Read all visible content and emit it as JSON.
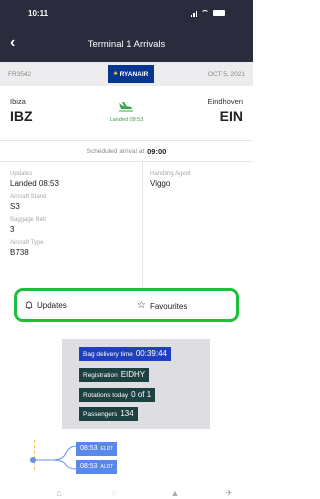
{
  "status_bar": {
    "time": "10:11"
  },
  "header": {
    "back_label": "‹",
    "title": "Terminal 1 Arrivals"
  },
  "flight": {
    "number": "FR3542",
    "airline": "RYANAIR",
    "date": "OCT 5, 2021",
    "from_city": "Ibiza",
    "from_code": "IBZ",
    "to_city": "Eindhoven",
    "to_code": "EIN",
    "status": "Landed 08:53",
    "scheduled_label": "Scheduled arrival at",
    "scheduled_time": "09:00"
  },
  "details": {
    "updates_label": "Updates",
    "updates_value": "Landed 08:53",
    "stand_label": "Aircraft Stand",
    "stand_value": "S3",
    "belt_label": "Baggage Belt",
    "belt_value": "3",
    "type_label": "Aircraft Type",
    "type_value": "B738",
    "agent_label": "Handling Agent",
    "agent_value": "Viggo"
  },
  "actions": {
    "updates": "Updates",
    "favourites": "Favourites"
  },
  "photo_tags": {
    "bag_delivery_label": "Bag delivery time",
    "bag_delivery_value": "00:39:44",
    "registration_label": "Registration",
    "registration_value": "EIDHY",
    "rotations_label": "Rotations today",
    "rotations_value": "0 of 1",
    "passengers_label": "Passengers",
    "passengers_value": "134"
  },
  "timeline": [
    {
      "time": "08:53",
      "code": "ELDT"
    },
    {
      "time": "08:53",
      "code": "ALDT"
    }
  ],
  "bottom_nav": [
    "home-icon",
    "chat-icon",
    "bell-icon",
    "plane-icon"
  ],
  "colors": {
    "header_bg": "#2b2b3e",
    "accent_green": "#1ebf3a",
    "landed_green": "#3aa64a",
    "ryanair_blue": "#073590",
    "timeline_blue": "#5a88ea"
  }
}
